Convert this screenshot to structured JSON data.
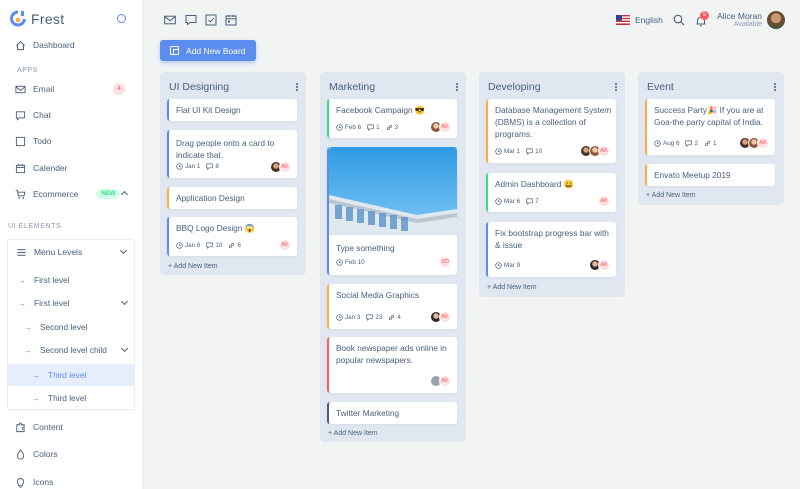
{
  "brand": {
    "name": "Frest"
  },
  "sidebar": {
    "dashboard": "Dashboard",
    "apps_heading": "APPS",
    "email": "Email",
    "email_badge": "4",
    "chat": "Chat",
    "todo": "Todo",
    "calender": "Calender",
    "ecommerce": "Ecommerce",
    "ecommerce_badge": "NEW",
    "ui_heading": "UI ELEMENTS",
    "menu_levels": "Menu Levels",
    "first_level_1": "First level",
    "first_level_2": "First level",
    "second_level": "Second level",
    "second_level_child": "Second level child",
    "third_level_1": "Third level",
    "third_level_2": "Third level",
    "content": "Content",
    "colors": "Colors",
    "icons": "Icons"
  },
  "topbar": {
    "language": "English",
    "notification_count": "5",
    "user_name": "Alice Moran",
    "user_status": "Available"
  },
  "add_board_label": "Add New Board",
  "colors": {
    "primary": "#5a8dee",
    "success": "#39da8a",
    "warning": "#fdac41",
    "danger": "#ff5b5c"
  },
  "boards": [
    {
      "title": "UI Designing",
      "add_item": "+ Add New Item",
      "cards": [
        {
          "text": "Flat UI Kit Design"
        },
        {
          "text": "Drag people onto a card to indicate that.",
          "date": "Jan 1",
          "comments": "8"
        },
        {
          "text": "Application Design"
        },
        {
          "text": "BBQ Logo Design 😱",
          "date": "Jan 6",
          "comments": "10",
          "attachments": "6"
        }
      ]
    },
    {
      "title": "Marketing",
      "add_item": "+ Add New Item",
      "cards": [
        {
          "text": "Facebook Campaign 😎",
          "date": "Feb 6",
          "comments": "1",
          "attachments": "3"
        },
        {
          "text": "Type something",
          "date": "Feb 10",
          "avatar": "SD"
        },
        {
          "text": "Social Media Graphics",
          "date": "Jan 3",
          "comments": "23",
          "attachments": "4"
        },
        {
          "text": "Book newspaper ads online in popular newspapers."
        },
        {
          "text": "Twitter Marketing"
        }
      ]
    },
    {
      "title": "Developing",
      "add_item": "+ Add New Item",
      "cards": [
        {
          "text": "Database Management System (DBMS) is a collection of programs.",
          "date": "Mar 1",
          "comments": "10"
        },
        {
          "text": "Admin Dashboard 😀",
          "date": "Mar 6",
          "comments": "7"
        },
        {
          "text": "Fix bootstrap progress bar with & issue",
          "date": "Mar 9"
        }
      ]
    },
    {
      "title": "Event",
      "add_item": "+ Add New Item",
      "cards": [
        {
          "text": "Success Party🎉 If you are at Goa-the party capital of India.",
          "date": "Aug 6",
          "comments": "2",
          "attachments": "1"
        },
        {
          "text": "Envato Meetup 2019"
        }
      ]
    }
  ],
  "avatar_initials": "AK"
}
